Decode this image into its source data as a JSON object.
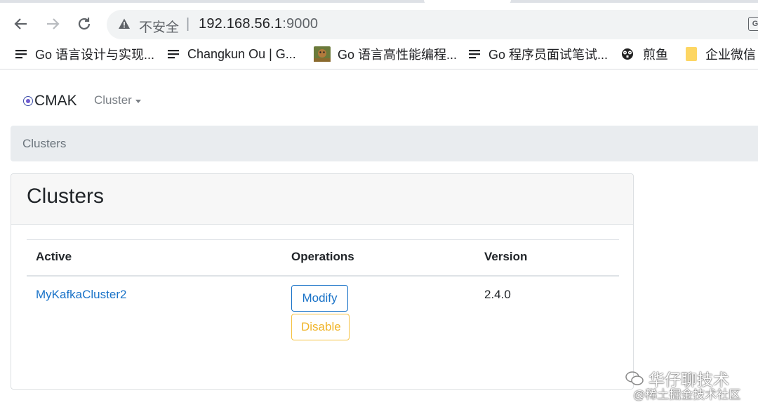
{
  "browser": {
    "security_label": "不安全",
    "url_host": "192.168.56.1",
    "url_port": ":9000",
    "extension_label": "G",
    "bookmarks": [
      {
        "label": "Go 语言设计与实现...",
        "icon": "lines-icon"
      },
      {
        "label": "Changkun Ou | G...",
        "icon": "lines-icon"
      },
      {
        "label": "Go 语言高性能编程...",
        "icon": "gopher-image-icon"
      },
      {
        "label": "Go 程序员面试笔试...",
        "icon": "lines-icon"
      },
      {
        "label": "煎鱼",
        "icon": "gopher-bw-icon"
      },
      {
        "label": "企业微信",
        "icon": "folder-icon"
      }
    ]
  },
  "navbar": {
    "brand": "CMAK",
    "cluster_menu": "Cluster"
  },
  "breadcrumb": {
    "current": "Clusters"
  },
  "card": {
    "title": "Clusters",
    "columns": [
      "Active",
      "Operations",
      "Version"
    ],
    "rows": [
      {
        "name": "MyKafkaCluster2",
        "modify_label": "Modify",
        "disable_label": "Disable",
        "version": "2.4.0"
      }
    ]
  },
  "watermark": {
    "line1": "华仔聊技术",
    "line2": "@稀土掘金技术社区"
  },
  "colors": {
    "link": "#1a73c8",
    "warning": "#f0b429",
    "breadcrumb_bg": "#e9ecef",
    "card_header_bg": "#f7f7f7"
  }
}
